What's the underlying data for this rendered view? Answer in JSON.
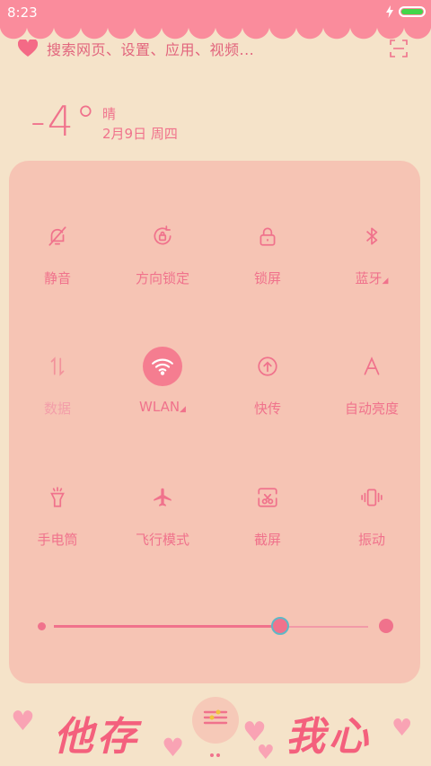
{
  "status_bar": {
    "time": "8:23",
    "battery_level": 1.0,
    "battery_color": "#42d64a"
  },
  "search": {
    "placeholder": "搜索网页、设置、应用、视频..."
  },
  "weather": {
    "temperature": "-4°",
    "condition": "晴",
    "date": "2月9日 周四"
  },
  "toggles": [
    {
      "label": "静音",
      "icon": "bell-off-icon",
      "state": "off"
    },
    {
      "label": "方向锁定",
      "icon": "rotation-lock-icon",
      "state": "off"
    },
    {
      "label": "锁屏",
      "icon": "lock-icon",
      "state": "off"
    },
    {
      "label": "蓝牙",
      "icon": "bluetooth-icon",
      "state": "off",
      "has_menu": true
    },
    {
      "label": "数据",
      "icon": "data-arrows-icon",
      "state": "disabled"
    },
    {
      "label": "WLAN",
      "icon": "wifi-icon",
      "state": "on",
      "has_menu": true
    },
    {
      "label": "快传",
      "icon": "upload-circle-icon",
      "state": "off"
    },
    {
      "label": "自动亮度",
      "icon": "auto-brightness-icon",
      "state": "off"
    },
    {
      "label": "手电筒",
      "icon": "flashlight-icon",
      "state": "off"
    },
    {
      "label": "飞行模式",
      "icon": "airplane-icon",
      "state": "off"
    },
    {
      "label": "截屏",
      "icon": "screenshot-icon",
      "state": "off"
    },
    {
      "label": "振动",
      "icon": "vibrate-icon",
      "state": "off"
    }
  ],
  "brightness": {
    "level": 0.72
  },
  "wallpaper": {
    "left_text": "他存",
    "right_text": "我心"
  },
  "colors": {
    "accent": "#f0728c",
    "panel": "#f6c4b4",
    "background": "#f5e3c9",
    "status_bar": "#fa8c9c"
  }
}
